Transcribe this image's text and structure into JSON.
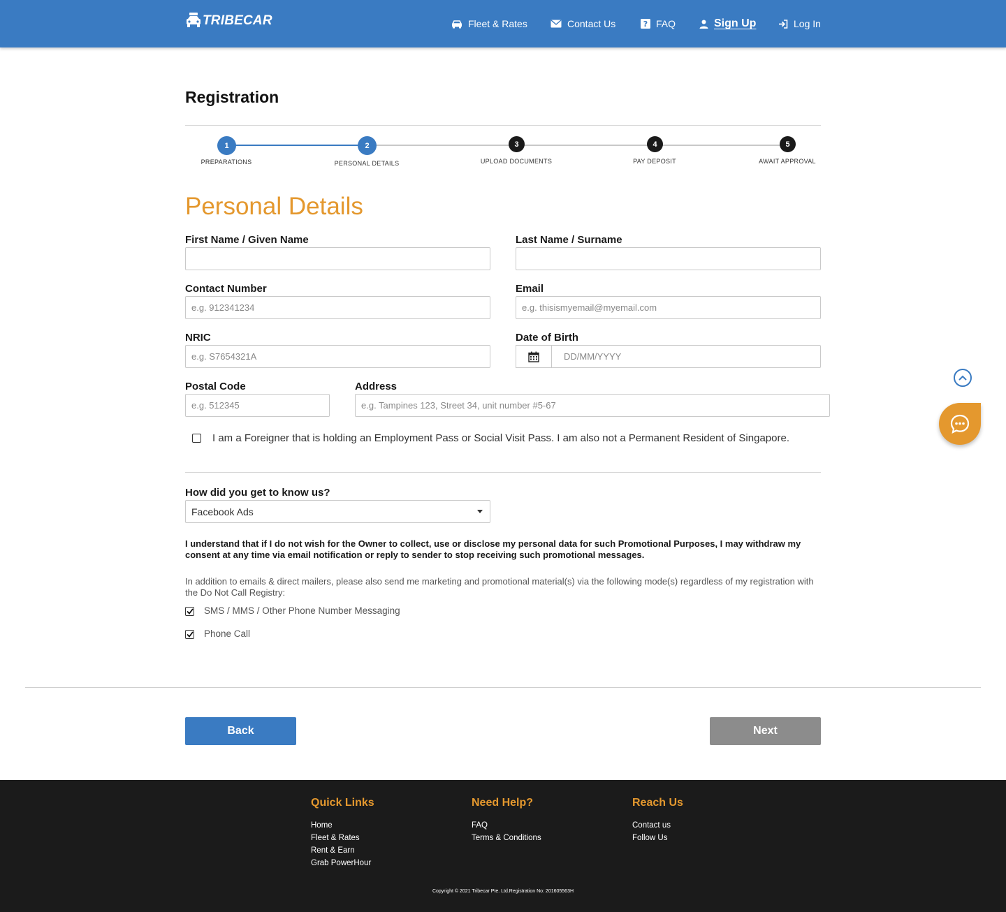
{
  "header": {
    "logo_text": "TRIBECAR",
    "nav": [
      {
        "label": "Fleet & Rates",
        "icon": "car-icon"
      },
      {
        "label": "Contact Us",
        "icon": "envelope-icon"
      },
      {
        "label": "FAQ",
        "icon": "question-icon"
      },
      {
        "label": "Sign Up",
        "icon": "user-icon",
        "active": true
      },
      {
        "label": "Log In",
        "icon": "login-icon"
      }
    ]
  },
  "page": {
    "title": "Registration"
  },
  "stepper": {
    "steps": [
      {
        "number": "1",
        "label": "PREPARATIONS",
        "state": "complete"
      },
      {
        "number": "2",
        "label": "PERSONAL DETAILS",
        "state": "current"
      },
      {
        "number": "3",
        "label": "UPLOAD DOCUMENTS",
        "state": "pending"
      },
      {
        "number": "4",
        "label": "PAY DEPOSIT",
        "state": "pending"
      },
      {
        "number": "5",
        "label": "AWAIT APPROVAL",
        "state": "pending"
      }
    ]
  },
  "form": {
    "section_title": "Personal Details",
    "first_name": {
      "label": "First Name / Given Name",
      "value": "",
      "placeholder": ""
    },
    "last_name": {
      "label": "Last Name / Surname",
      "value": "",
      "placeholder": ""
    },
    "contact": {
      "label": "Contact Number",
      "placeholder": "e.g. 912341234"
    },
    "email": {
      "label": "Email",
      "placeholder": "e.g. thisismyemail@myemail.com"
    },
    "nric": {
      "label": "NRIC",
      "placeholder": "e.g. S7654321A"
    },
    "dob": {
      "label": "Date of Birth",
      "placeholder": "DD/MM/YYYY"
    },
    "postal": {
      "label": "Postal Code",
      "placeholder": "e.g. 512345"
    },
    "address": {
      "label": "Address",
      "placeholder": "e.g. Tampines 123, Street 34, unit number #5-67"
    },
    "foreigner": {
      "label": "I am a Foreigner that is holding an Employment Pass or Social Visit Pass. I am also not a Permanent Resident of Singapore.",
      "checked": false
    },
    "referral": {
      "label": "How did you get to know us?",
      "selected": "Facebook Ads"
    },
    "consent_bold": "I understand that if I do not wish for the Owner to collect, use or disclose my personal data for such Promotional Purposes, I may withdraw my consent at any time via email notification or reply to sender to stop receiving such promotional messages.",
    "consent_plain": "In addition to emails & direct mailers, please also send me marketing and promotional material(s) via the following mode(s) regardless of my registration with the Do Not Call Registry:",
    "opt_sms": {
      "label": "SMS / MMS / Other Phone Number Messaging",
      "checked": true
    },
    "opt_call": {
      "label": "Phone Call",
      "checked": true
    }
  },
  "buttons": {
    "back": "Back",
    "next": "Next"
  },
  "footer": {
    "quick_links": {
      "heading": "Quick Links",
      "links": [
        "Home",
        "Fleet & Rates",
        "Rent & Earn",
        "Grab PowerHour"
      ]
    },
    "need_help": {
      "heading": "Need Help?",
      "links": [
        "FAQ",
        "Terms & Conditions"
      ]
    },
    "reach_us": {
      "heading": "Reach Us",
      "links": [
        "Contact us",
        "Follow Us"
      ]
    },
    "copyright": "Copyright © 2021 Tribecar Pte. Ltd.Registration No: 201605563H"
  },
  "colors": {
    "primary": "#3a7bc2",
    "accent": "#e4982e",
    "pending_step": "#1a1a1a",
    "next_disabled": "#8c8c8c",
    "footer_bg": "#1b1b1b"
  }
}
